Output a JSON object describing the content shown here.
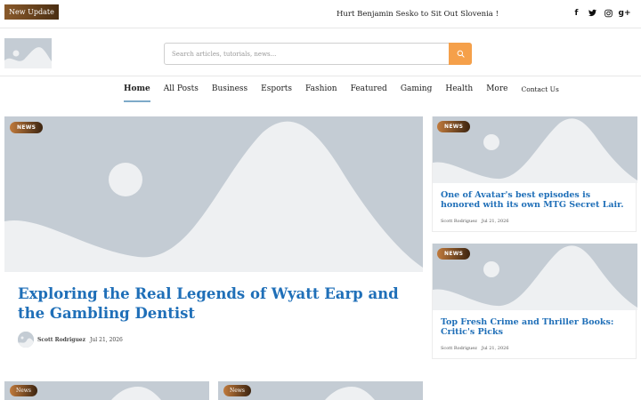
{
  "topbar": {
    "badge": "New Update",
    "ticker": "Hurt Benjamin Sesko to Sit Out Slovenia !",
    "social": [
      {
        "icon": "facebook-icon",
        "glyph": "f"
      },
      {
        "icon": "twitter-icon",
        "glyph": "t"
      },
      {
        "icon": "instagram-icon",
        "glyph": "◎"
      },
      {
        "icon": "google-plus-icon",
        "glyph": "g+"
      }
    ]
  },
  "search": {
    "placeholder": "Search articles, tutorials, news..."
  },
  "nav": {
    "items": [
      {
        "label": "Home",
        "active": true
      },
      {
        "label": "All Posts"
      },
      {
        "label": "Business"
      },
      {
        "label": "Esports"
      },
      {
        "label": "Fashion"
      },
      {
        "label": "Featured"
      },
      {
        "label": "Gaming"
      },
      {
        "label": "Health"
      },
      {
        "label": "More"
      },
      {
        "label": "Contact Us"
      }
    ]
  },
  "featured": {
    "category": "NEWS",
    "title": "Exploring the Real Legends of Wyatt Earp and the Gambling Dentist",
    "author": "Scott Rodriguez",
    "date": "Jul 21, 2026"
  },
  "side": [
    {
      "category": "NEWS",
      "title": "One of Avatar's best episodes is honored with its own MTG Secret Lair.",
      "author": "Scott Rodriguez",
      "date": "Jul 21, 2026"
    },
    {
      "category": "NEWS",
      "title": "Top Fresh Crime and Thriller Books: Critic's Picks",
      "author": "Scott Rodriguez",
      "date": "Jul 21, 2026"
    }
  ],
  "bottom": [
    {
      "category": "News"
    },
    {
      "category": "News"
    }
  ],
  "colors": {
    "accent": "#1f6fb8",
    "search_button": "#f5a04a",
    "placeholder_bg": "#c4ccd4"
  }
}
